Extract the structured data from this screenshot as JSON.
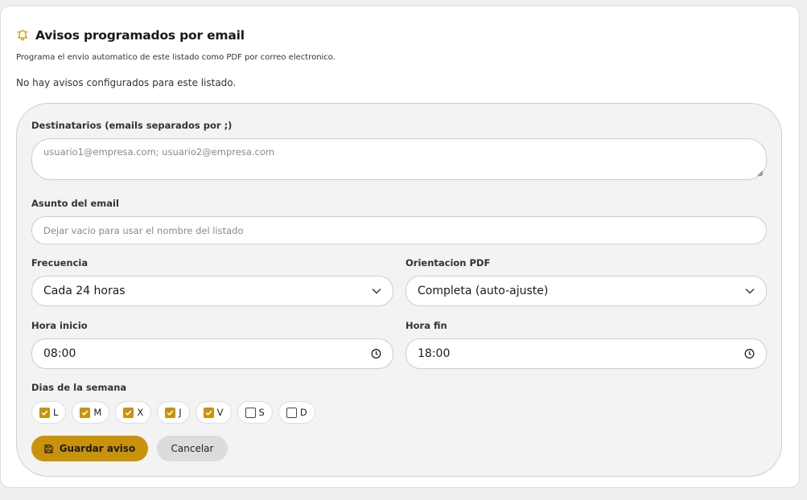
{
  "header": {
    "title": "Avisos programados por email",
    "subtitle": "Programa el envio automatico de este listado como PDF por correo electronico.",
    "empty_message": "No hay avisos configurados para este listado.",
    "icon": "bell-icon"
  },
  "form": {
    "recipients": {
      "label": "Destinatarios (emails separados por ;)",
      "placeholder": "usuario1@empresa.com; usuario2@empresa.com"
    },
    "subject": {
      "label": "Asunto del email",
      "placeholder": "Dejar vacio para usar el nombre del listado"
    },
    "frequency": {
      "label": "Frecuencia",
      "value": "Cada 24 horas"
    },
    "orientation": {
      "label": "Orientacion PDF",
      "value": "Completa (auto-ajuste)"
    },
    "start_time": {
      "label": "Hora inicio",
      "value": "08:00"
    },
    "end_time": {
      "label": "Hora fin",
      "value": "18:00"
    },
    "days": {
      "label": "Dias de la semana",
      "items": [
        {
          "label": "L",
          "checked": true
        },
        {
          "label": "M",
          "checked": true
        },
        {
          "label": "X",
          "checked": true
        },
        {
          "label": "J",
          "checked": true
        },
        {
          "label": "V",
          "checked": true
        },
        {
          "label": "S",
          "checked": false
        },
        {
          "label": "D",
          "checked": false
        }
      ]
    },
    "save_label": "Guardar aviso",
    "cancel_label": "Cancelar"
  },
  "colors": {
    "accent": "#c8920a",
    "panel": "#f3f3f3",
    "cancel": "#dcdcdc"
  }
}
